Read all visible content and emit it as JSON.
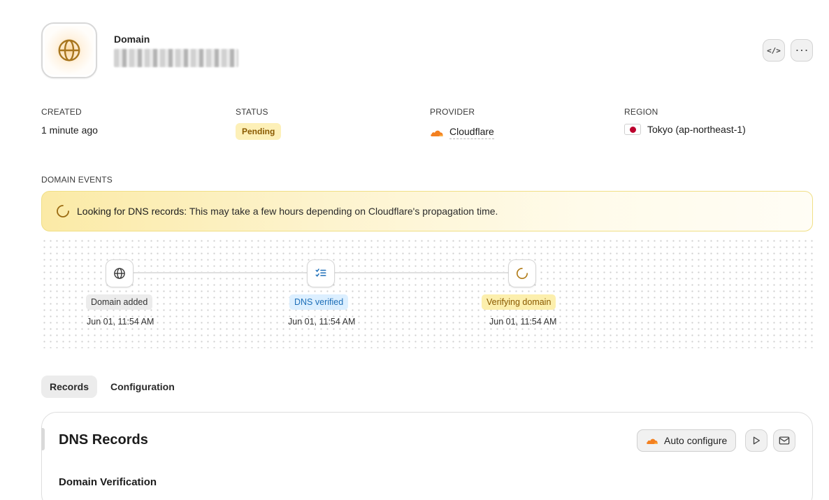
{
  "header": {
    "kicker": "Domain",
    "icons": {
      "logo": "globe-icon",
      "code": "code-icon",
      "more": "more-icon"
    },
    "code_label": "</>",
    "more_label": "···"
  },
  "meta": {
    "created": {
      "label": "CREATED",
      "value": "1 minute ago"
    },
    "status": {
      "label": "STATUS",
      "value": "Pending"
    },
    "provider": {
      "label": "PROVIDER",
      "value": "Cloudflare",
      "icon": "cloudflare-icon"
    },
    "region": {
      "label": "REGION",
      "value": "Tokyo (ap-northeast-1)",
      "icon": "japan-flag-icon"
    }
  },
  "events": {
    "label": "DOMAIN EVENTS",
    "banner": {
      "title": "Looking for DNS records:",
      "text": "This may take a few hours depending on Cloudflare's propagation time.",
      "icon": "spinner-icon"
    },
    "timeline": [
      {
        "label": "Domain added",
        "date": "Jun 01, 11:54 AM",
        "icon": "globe-icon",
        "tone": "gray"
      },
      {
        "label": "DNS verified",
        "date": "Jun 01, 11:54 AM",
        "icon": "checklist-icon",
        "tone": "blue"
      },
      {
        "label": "Verifying domain",
        "date": "Jun 01, 11:54 AM",
        "icon": "spinner-icon",
        "tone": "yellow"
      }
    ]
  },
  "tabs": [
    {
      "label": "Records",
      "active": true
    },
    {
      "label": "Configuration",
      "active": false
    }
  ],
  "dns": {
    "title": "DNS Records",
    "auto_configure_label": "Auto configure",
    "auto_configure_icon": "cloudflare-icon",
    "play_icon": "play-icon",
    "mail_icon": "mail-icon",
    "section_title": "Domain Verification"
  },
  "colors": {
    "pending_bg": "#fdf0b8",
    "pending_text": "#8a5a00",
    "dns_verified_bg": "#dcefff",
    "dns_verified_text": "#1e6fb8",
    "banner_bg": "#fbeaa6",
    "cloudflare_orange": "#f38020",
    "globe_gold": "#a8761f"
  }
}
